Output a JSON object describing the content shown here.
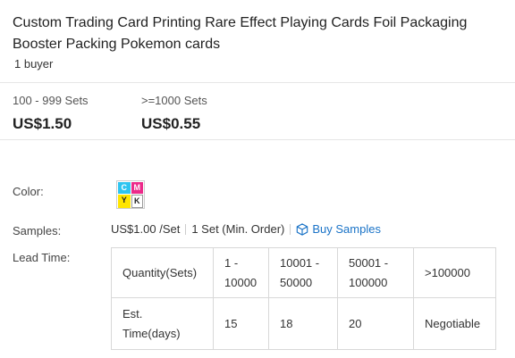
{
  "product": {
    "title": "Custom Trading Card Printing Rare Effect Playing Cards Foil Packaging Booster Packing Pokemon cards",
    "buyers": "1 buyer"
  },
  "price_tiers": [
    {
      "range": "100 - 999 Sets",
      "price": "US$1.50"
    },
    {
      "range": ">=1000 Sets",
      "price": "US$0.55"
    }
  ],
  "color": {
    "label": "Color:",
    "swatch_letters": [
      "C",
      "M",
      "Y",
      "K"
    ],
    "swatch_colors": [
      "#2ec4f0",
      "#ec2a8a",
      "#ffe500",
      "#ffffff"
    ]
  },
  "samples": {
    "label": "Samples:",
    "price": "US$1.00 /Set",
    "min_order": "1 Set (Min. Order)",
    "buy_label": "Buy Samples",
    "icon": "cube-icon",
    "link_color": "#1a73c7"
  },
  "lead_time": {
    "label": "Lead Time:",
    "header_label": "Quantity(Sets)",
    "quantities": [
      "1 - 10000",
      "10001 - 50000",
      "50001 - 100000",
      ">100000"
    ],
    "time_label": "Est. Time(days)",
    "days": [
      "15",
      "18",
      "20",
      "Negotiable"
    ]
  }
}
